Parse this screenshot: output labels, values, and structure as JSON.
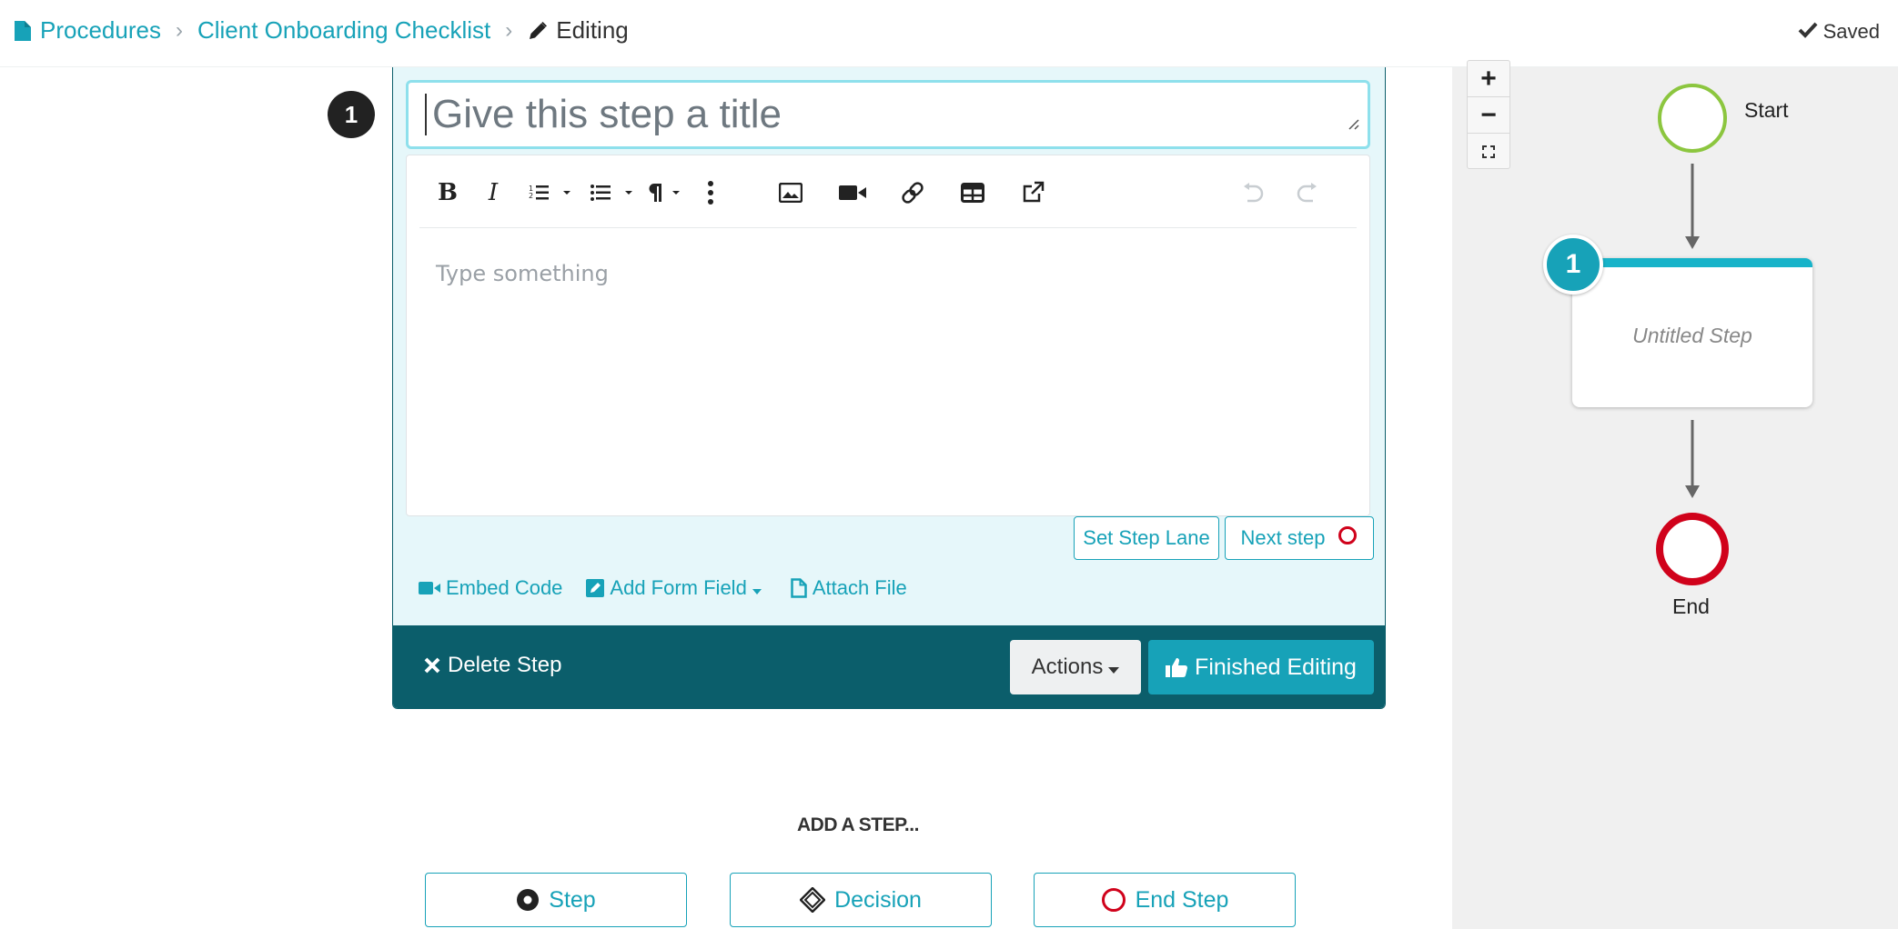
{
  "breadcrumb": {
    "root": "Procedures",
    "procedure": "Client Onboarding Checklist",
    "current": "Editing"
  },
  "status": {
    "saved": "Saved"
  },
  "zoom": {
    "in": "+",
    "out": "−"
  },
  "step_editor": {
    "step_number": "1",
    "title_placeholder": "Give this step a title",
    "body_placeholder": "Type something",
    "set_lane": "Set Step Lane",
    "next_step": "Next step",
    "embed_code": "Embed Code",
    "add_form_field": "Add Form Field",
    "attach_file": "Attach File",
    "delete_step": "Delete Step",
    "actions": "Actions",
    "finished_editing": "Finished Editing"
  },
  "add_step": {
    "title": "ADD A STEP...",
    "step": "Step",
    "decision": "Decision",
    "end_step": "End Step"
  },
  "diagram": {
    "start": "Start",
    "step_number": "1",
    "step_label": "Untitled Step",
    "end": "End"
  },
  "colors": {
    "accent": "#17a2b8",
    "dark_teal": "#0b5e6b",
    "start_ring": "#8cc63f",
    "end_ring": "#d0021b"
  }
}
